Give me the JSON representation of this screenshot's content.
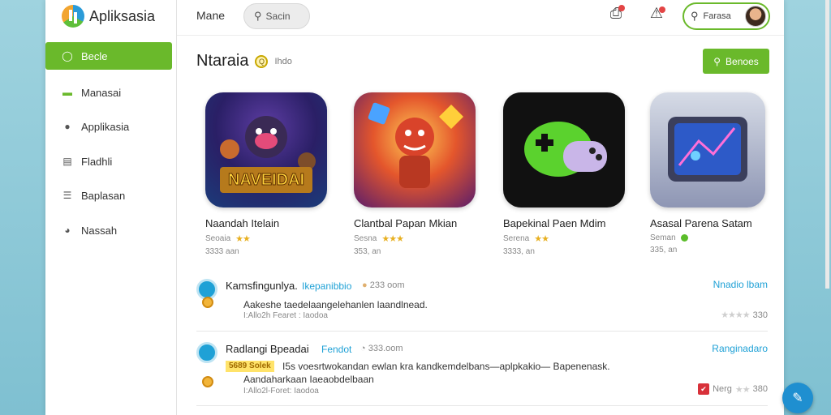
{
  "app": {
    "title": "Apliksasia"
  },
  "header": {
    "title": "Mane",
    "search_label": "Sacin",
    "user_label": "Farasa"
  },
  "sidebar": {
    "items": [
      {
        "label": "Becle",
        "icon": "circle-icon",
        "active": true
      },
      {
        "label": "Manasai",
        "icon": "folder-icon",
        "active": false
      },
      {
        "label": "Applikasia",
        "icon": "chat-icon",
        "active": false
      },
      {
        "label": "Fladhli",
        "icon": "document-icon",
        "active": false
      },
      {
        "label": "Baplasan",
        "icon": "list-icon",
        "active": false
      },
      {
        "label": "Nassah",
        "icon": "info-icon",
        "active": false
      }
    ]
  },
  "main": {
    "section_title": "Ntaraia",
    "section_sub": "Ihdo",
    "primary_button": "Benoes",
    "apps": [
      {
        "name": "Naandah Itelain",
        "category": "Seoaia",
        "count": "3333 aan",
        "stars": "★★",
        "icon_text": "NAVEIDAI"
      },
      {
        "name": "Clantbal Papan Mkian",
        "category": "Sesna",
        "count": "353, an",
        "stars": "★★★",
        "icon_text": ""
      },
      {
        "name": "Bapekinal Paen Mdim",
        "category": "Serena",
        "count": "3333, an",
        "stars": "★★",
        "icon_text": ""
      },
      {
        "name": "Asasal Parena Satam",
        "category": "Seman",
        "count": "335, an",
        "stars": "",
        "icon_text": ""
      }
    ],
    "reviews": [
      {
        "name": "Kamsfingunlya.",
        "tag": "Ikepanibbio",
        "time": "233 oom",
        "text": "Aakeshe taedelaangelehanlen laandlnead.",
        "sub": "I:Allo2h Fearet : Iaodoa",
        "link": "Nnadio lbam",
        "rating": "330",
        "highlight": ""
      },
      {
        "name": "Radlangi Bpeadai",
        "tag": "Fendot",
        "time": "333.oom",
        "text": "I5s voesrtwokandan ewlan kra kandkemdelbans—aplpkakio— Bapenenask.",
        "sub": "I:Allo2l-Foret: Iaodoa",
        "line2": "Aandaharkaan Iaeaobdelbaan",
        "link": "Ranginadaro",
        "rating": "380",
        "rating_prefix": "Nerg",
        "highlight": "5689 Solek"
      }
    ]
  }
}
